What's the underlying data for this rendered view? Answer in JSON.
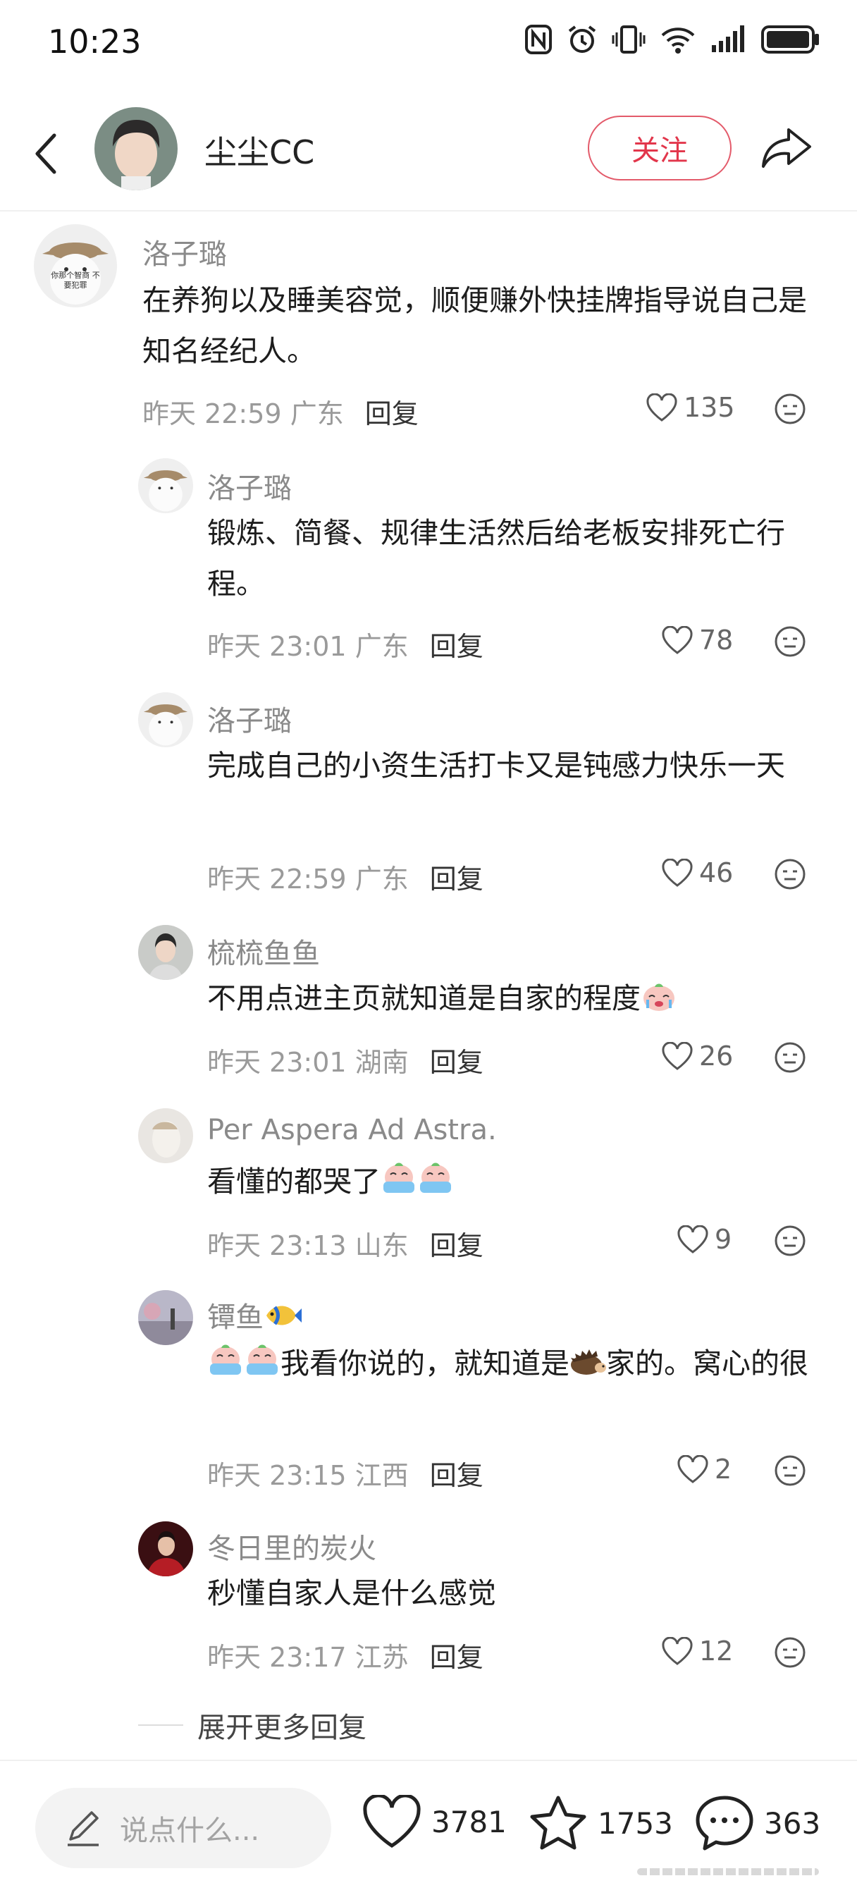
{
  "status_bar": {
    "time": "10:23"
  },
  "header": {
    "username": "尘尘CC",
    "follow_label": "关注"
  },
  "comments": [
    {
      "name": "洛子璐",
      "text": "在养狗以及睡美容觉，顺便赚外快挂牌指导说自己是知名经纪人。",
      "time": "昨天 22:59",
      "location": "广东",
      "reply_label": "回复",
      "likes": "135",
      "avatar_text": "你那个智商 不要犯罪"
    },
    {
      "name": "洛子璐",
      "text": "锻炼、简餐、规律生活然后给老板安排死亡行程。",
      "time": "昨天 23:01",
      "location": "广东",
      "reply_label": "回复",
      "likes": "78"
    },
    {
      "name": "洛子璐",
      "text": "完成自己的小资生活打卡又是钝感力快乐一天",
      "time": "昨天 22:59",
      "location": "广东",
      "reply_label": "回复",
      "likes": "46"
    },
    {
      "name": "梳梳鱼鱼",
      "text": "不用点进主页就知道是自家的程度",
      "time": "昨天 23:01",
      "location": "湖南",
      "reply_label": "回复",
      "likes": "26"
    },
    {
      "name": "Per Aspera Ad Astra.",
      "text": "看懂的都哭了",
      "time": "昨天 23:13",
      "location": "山东",
      "reply_label": "回复",
      "likes": "9"
    },
    {
      "name": "镡鱼",
      "text_a": "我看你说的，就知道是",
      "text_b": "家的。窝心的很",
      "time": "昨天 23:15",
      "location": "江西",
      "reply_label": "回复",
      "likes": "2"
    },
    {
      "name": "冬日里的炭火",
      "text": "秒懂自家人是什么感觉",
      "time": "昨天 23:17",
      "location": "江苏",
      "reply_label": "回复",
      "likes": "12"
    }
  ],
  "expand_label": "展开更多回复",
  "bottom_bar": {
    "input_placeholder": "说点什么...",
    "likes": "3781",
    "favorites": "1753",
    "comments": "363"
  },
  "colors": {
    "accent": "#e2364b",
    "meta": "#9a9a9a"
  }
}
